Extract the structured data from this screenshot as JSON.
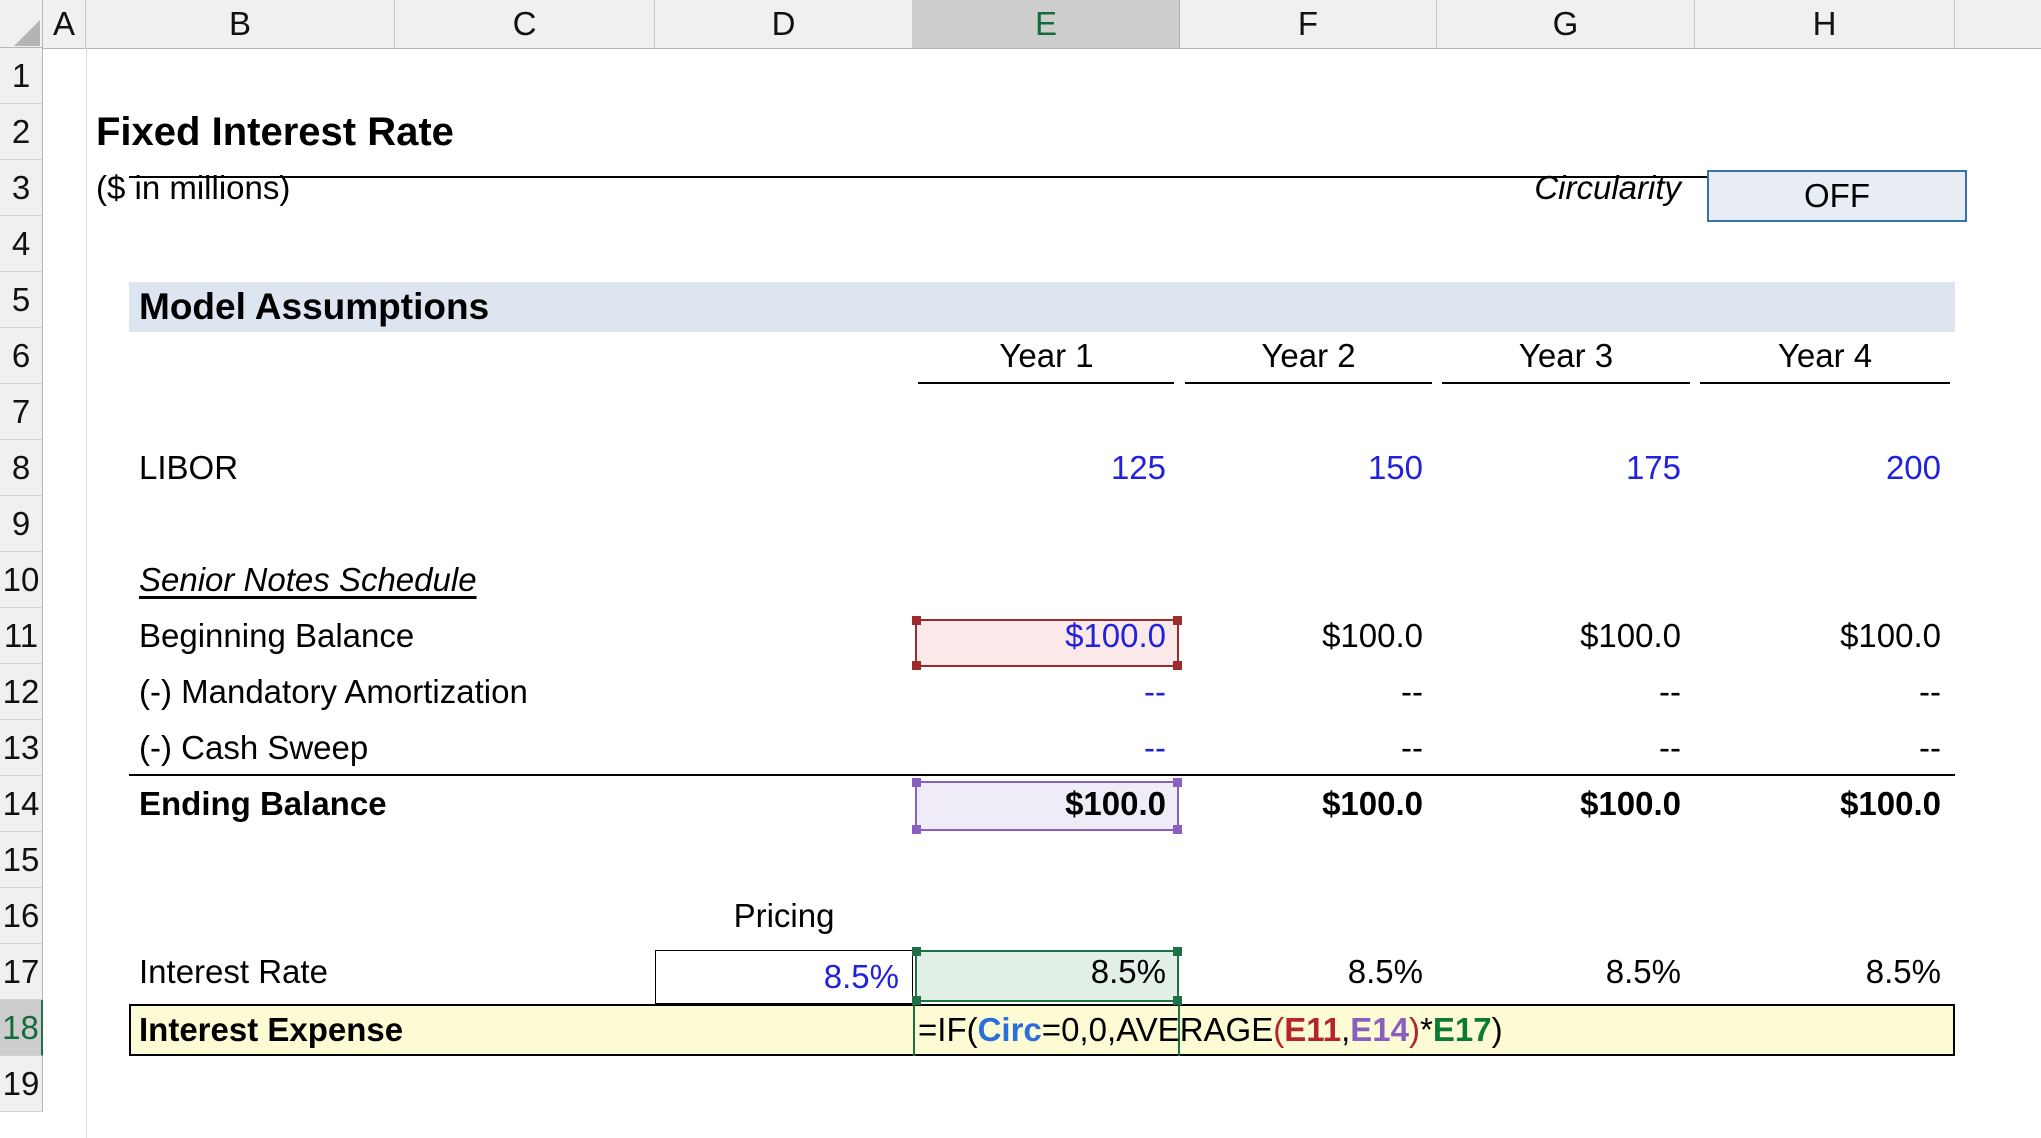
{
  "app": {
    "type": "spreadsheet",
    "mode": "formula-edit",
    "selected_cell": "E18",
    "selected_column": "E",
    "selected_row": "18"
  },
  "columns": [
    {
      "label": "A"
    },
    {
      "label": "B"
    },
    {
      "label": "C"
    },
    {
      "label": "D"
    },
    {
      "label": "E"
    },
    {
      "label": "F"
    },
    {
      "label": "G"
    },
    {
      "label": "H"
    }
  ],
  "rows": [
    "1",
    "2",
    "3",
    "4",
    "5",
    "6",
    "7",
    "8",
    "9",
    "10",
    "11",
    "12",
    "13",
    "14",
    "15",
    "16",
    "17",
    "18",
    "19"
  ],
  "titles": {
    "main": "Fixed Interest Rate",
    "units": "($ in millions)",
    "section": "Model Assumptions",
    "schedule": "Senior Notes Schedule"
  },
  "circularity": {
    "label": "Circularity",
    "value": "OFF"
  },
  "year_headers": [
    "Year 1",
    "Year 2",
    "Year 3",
    "Year 4"
  ],
  "labels": {
    "libor": "LIBOR",
    "beginning_balance": "Beginning Balance",
    "mandatory_amortization": "(-) Mandatory Amortization",
    "cash_sweep": "(-) Cash Sweep",
    "ending_balance": "Ending Balance",
    "pricing": "Pricing",
    "interest_rate": "Interest Rate",
    "interest_expense": "Interest Expense"
  },
  "values": {
    "libor": [
      "125",
      "150",
      "175",
      "200"
    ],
    "beginning_balance": [
      "$100.0",
      "$100.0",
      "$100.0",
      "$100.0"
    ],
    "mandatory_amortization": [
      "--",
      "--",
      "--",
      "--"
    ],
    "cash_sweep": [
      "--",
      "--",
      "--",
      "--"
    ],
    "ending_balance": [
      "$100.0",
      "$100.0",
      "$100.0",
      "$100.0"
    ],
    "pricing": "8.5%",
    "interest_rate": [
      "8.5%",
      "8.5%",
      "8.5%",
      "8.5%"
    ]
  },
  "formula": {
    "full": "=IF(Circ=0,0,AVERAGE(E11,E14)*E17)",
    "tokens": [
      {
        "text": "=IF(",
        "kind": "plain"
      },
      {
        "text": "Circ",
        "kind": "name"
      },
      {
        "text": "=0,0,AVERAGE",
        "kind": "plain"
      },
      {
        "text": "(",
        "kind": "paren-red"
      },
      {
        "text": "E11",
        "kind": "ref-red"
      },
      {
        "text": ",",
        "kind": "plain"
      },
      {
        "text": "E14",
        "kind": "ref-purple"
      },
      {
        "text": ")",
        "kind": "paren-red"
      },
      {
        "text": "*",
        "kind": "plain"
      },
      {
        "text": "E17",
        "kind": "ref-green"
      },
      {
        "text": ")",
        "kind": "plain"
      }
    ]
  },
  "colors": {
    "selected_header": "#cdcdcd",
    "selected_text": "#136b3c",
    "banner": "#dde6f0",
    "input_blue": "#2222dd",
    "edit_row_fill": "#fcfbd4",
    "toggle_fill": "#e8edf5",
    "toggle_border": "#3b6fa8",
    "ref_red": "#9e2b2b",
    "ref_purple": "#8a5fc0",
    "ref_green": "#1e7145"
  }
}
